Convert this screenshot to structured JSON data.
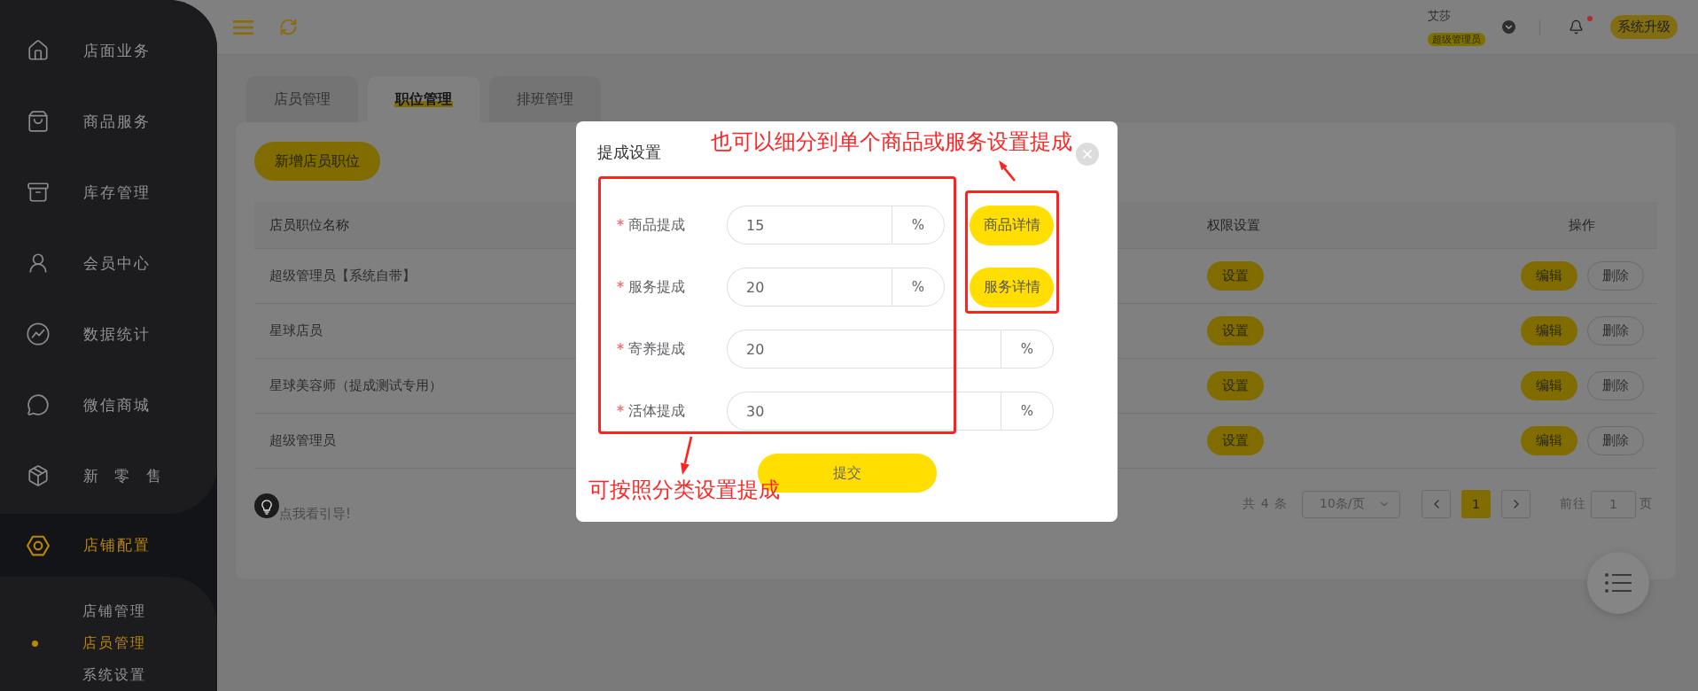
{
  "topbar": {
    "user": {
      "name": "艾莎",
      "role": "超级管理员"
    },
    "notifications": {
      "unread": true
    },
    "upgrade_button": "系统升级"
  },
  "sidebar": {
    "items": [
      {
        "label": "店面业务",
        "selected": false
      },
      {
        "label": "商品服务",
        "selected": false
      },
      {
        "label": "库存管理",
        "selected": false
      },
      {
        "label": "会员中心",
        "selected": false
      },
      {
        "label": "数据统计",
        "selected": false
      },
      {
        "label": "微信商城",
        "selected": false
      },
      {
        "label": "新 零 售",
        "selected": false
      },
      {
        "label": "店铺配置",
        "selected": true,
        "expanded": true,
        "children": [
          {
            "label": "店铺管理",
            "selected": false
          },
          {
            "label": "店员管理",
            "selected": true
          },
          {
            "label": "系统设置",
            "selected": false
          }
        ]
      }
    ]
  },
  "tabs": [
    {
      "label": "店员管理",
      "selected": false
    },
    {
      "label": "职位管理",
      "selected": true
    },
    {
      "label": "排班管理",
      "selected": false
    }
  ],
  "add_button": "新增店员职位",
  "table": {
    "columns": [
      "店员职位名称",
      "权限设置",
      "操作"
    ],
    "rows": [
      {
        "name": "超级管理员【系统自带】",
        "permission_button": "设置",
        "actions": [
          {
            "label": "编辑",
            "kind": "primary"
          },
          {
            "label": "删除",
            "kind": "outline"
          }
        ]
      },
      {
        "name": "星球店员",
        "permission_button": "设置",
        "actions": [
          {
            "label": "编辑",
            "kind": "primary"
          },
          {
            "label": "删除",
            "kind": "outline"
          }
        ]
      },
      {
        "name": "星球美容师（提成测试专用）",
        "permission_button": "设置",
        "actions": [
          {
            "label": "编辑",
            "kind": "primary"
          },
          {
            "label": "删除",
            "kind": "outline"
          }
        ]
      },
      {
        "name": "超级管理员",
        "permission_button": "设置",
        "actions": [
          {
            "label": "编辑",
            "kind": "primary"
          },
          {
            "label": "删除",
            "kind": "outline"
          }
        ]
      }
    ]
  },
  "guide_link": "点我看引导!",
  "pagination": {
    "total": "共 4 条",
    "page_size": "10条/页",
    "pages": [
      {
        "label": "1",
        "selected": true
      }
    ],
    "goto_label": "前往",
    "goto_value": "1",
    "goto_suffix": "页"
  },
  "modal": {
    "title": "提成设置",
    "fields": [
      {
        "label": "商品提成",
        "required": true,
        "value": "15",
        "suffix": "%",
        "detail_button": "商品详情"
      },
      {
        "label": "服务提成",
        "required": true,
        "value": "20",
        "suffix": "%",
        "detail_button": "服务详情"
      },
      {
        "label": "寄养提成",
        "required": true,
        "value": "20",
        "suffix": "%"
      },
      {
        "label": "活体提成",
        "required": true,
        "value": "30",
        "suffix": "%"
      }
    ],
    "submit_button": "提交"
  },
  "annotations": [
    {
      "text": "也可以细分到单个商品或服务设置提成"
    },
    {
      "text": "可按照分类设置提成"
    }
  ]
}
